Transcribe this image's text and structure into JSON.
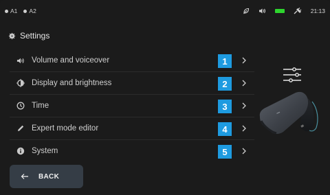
{
  "status": {
    "left_items": [
      "A1",
      "A2"
    ],
    "icons": [
      "eco-leaf-icon",
      "volume-icon",
      "battery-icon",
      "charging-plug-icon"
    ],
    "battery_color": "#2ed52e",
    "time": "21:13"
  },
  "header": {
    "title": "Settings"
  },
  "menu": {
    "items": [
      {
        "label": "Volume and voiceover",
        "number": "1",
        "icon": "volume-icon"
      },
      {
        "label": "Display and brightness",
        "number": "2",
        "icon": "brightness-icon"
      },
      {
        "label": "Time",
        "number": "3",
        "icon": "clock-icon"
      },
      {
        "label": "Expert mode editor",
        "number": "4",
        "icon": "pencil-icon"
      },
      {
        "label": "System",
        "number": "5",
        "icon": "info-icon"
      }
    ]
  },
  "back": {
    "label": "BACK"
  },
  "colors": {
    "accent": "#1e9be0",
    "background": "#1b1b1b",
    "button": "#353d46"
  }
}
